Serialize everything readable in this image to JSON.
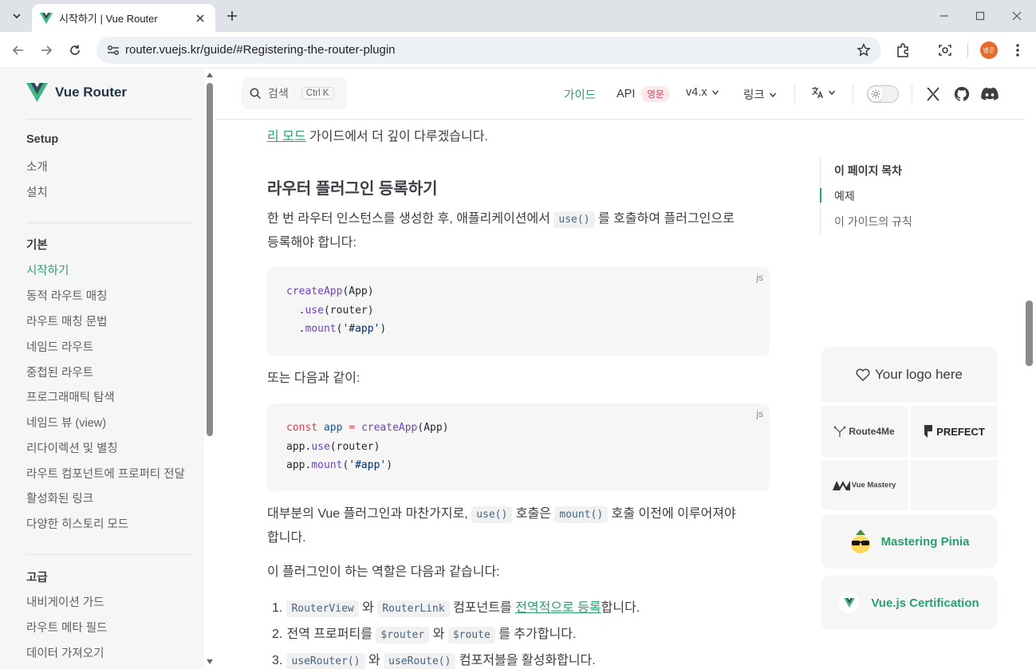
{
  "browser": {
    "tab_title": "시작하기 | Vue Router",
    "url": "router.vuejs.kr/guide/#Registering-the-router-plugin",
    "profile_initials": "병준"
  },
  "header": {
    "brand": "Vue Router",
    "search_label": "검색",
    "search_shortcut": "Ctrl K",
    "nav": {
      "guide": "가이드",
      "api": "API",
      "api_badge": "영문",
      "version": "v4.x",
      "links": "링크"
    }
  },
  "sidebar": {
    "groups": [
      {
        "title": "Setup",
        "items": [
          "소개",
          "설치"
        ]
      },
      {
        "title": "기본",
        "items": [
          "시작하기",
          "동적 라우트 매칭",
          "라우트 매칭 문법",
          "네임드 라우트",
          "중첩된 라우트",
          "프로그래매틱 탐색",
          "네임드 뷰 (view)",
          "리다이렉션 및 별칭",
          "라우트 컴포넌트에 프로퍼티 전달",
          "활성화된 링크",
          "다양한 히스토리 모드"
        ]
      },
      {
        "title": "고급",
        "items": [
          "내비게이션 가드",
          "라우트 메타 필드",
          "데이터 가져오기"
        ]
      }
    ],
    "active_item": "시작하기"
  },
  "content": {
    "top_text_link": "리 모드",
    "top_text_rest": " 가이드에서 더 깊이 다루겠습니다.",
    "heading": "라우터 플러그인 등록하기",
    "intro_a": "한 번 라우터 인스턴스를 생성한 후, 애플리케이션에서 ",
    "intro_code": "use()",
    "intro_b": " 를 호출하여 플러그인으로",
    "intro_c": "등록해야 합니다:",
    "code1": {
      "lang": "js",
      "line1_fn": "createApp",
      "line1_rest": "(App)",
      "line2_dot": "  .",
      "line2_fn": "use",
      "line2_rest": "(router)",
      "line3_dot": "  .",
      "line3_fn": "mount",
      "line3_open": "(",
      "line3_str": "'#app'",
      "line3_close": ")"
    },
    "or_text": "또는 다음과 같이:",
    "code2": {
      "lang": "js",
      "kw_const": "const",
      "var_app": "app",
      "op_eq": "=",
      "fn_create": "createApp",
      "line1_rest": "(App)",
      "line2_obj": "app.",
      "line2_fn": "use",
      "line2_rest": "(router)",
      "line3_obj": "app.",
      "line3_fn": "mount",
      "line3_open": "(",
      "line3_str": "'#app'",
      "line3_close": ")"
    },
    "para2_a": "대부분의 Vue 플러그인과 마찬가지로, ",
    "para2_code1": "use()",
    "para2_b": " 호출은 ",
    "para2_code2": "mount()",
    "para2_c": " 호출 이전에 이루어져야",
    "para2_d": "합니다.",
    "para3": "이 플러그인이 하는 역할은 다음과 같습니다:",
    "list": {
      "item1_num": "1.",
      "item1_code1": "RouterView",
      "item1_a": " 와 ",
      "item1_code2": "RouterLink",
      "item1_b": " 컴포넌트를 ",
      "item1_link": "전역적으로 등록",
      "item1_c": "합니다.",
      "item2_num": "2.",
      "item2_a": "전역 프로퍼티를 ",
      "item2_code1": "$router",
      "item2_b": " 와 ",
      "item2_code2": "$route",
      "item2_c": " 를 추가합니다.",
      "item3_num": "3.",
      "item3_code1": "useRouter()",
      "item3_a": " 와 ",
      "item3_code2": "useRoute()",
      "item3_b": " 컴포저블을 활성화합니다."
    }
  },
  "outline": {
    "title": "이 페이지 목차",
    "items": [
      "예제",
      "이 가이드의 규칙"
    ]
  },
  "sponsors": {
    "your_logo": "Your logo here",
    "route4me": "Route4Me",
    "prefect": "PREFECT",
    "vue_mastery": "Vue Mastery",
    "mastering_pinia": "Mastering Pinia",
    "vue_certification": "Vue.js Certification"
  },
  "colors": {
    "brand_green": "#28a16d",
    "vue_dark": "#35495e"
  }
}
